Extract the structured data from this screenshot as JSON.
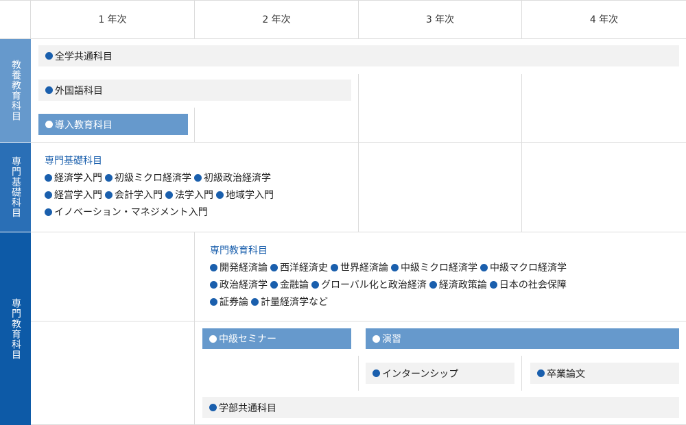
{
  "years": [
    "1 年次",
    "2 年次",
    "3 年次",
    "4 年次"
  ],
  "categories": {
    "general": "教養教育科目",
    "basic": "専門基礎科目",
    "specialized": "専門教育科目"
  },
  "general": {
    "all_common": "全学共通科目",
    "foreign_language": "外国語科目",
    "intro": "導入教育科目"
  },
  "basic": {
    "title": "専門基礎科目",
    "rows": [
      [
        "経済学入門",
        "初級ミクロ経済学",
        "初級政治経済学"
      ],
      [
        "経営学入門",
        "会計学入門",
        "法学入門",
        "地域学入門"
      ],
      [
        "イノベーション・マネジメント入門"
      ]
    ]
  },
  "specialized": {
    "title": "専門教育科目",
    "rows": [
      [
        "開発経済論",
        "西洋経済史",
        "世界経済論",
        "中級ミクロ経済学",
        "中級マクロ経済学"
      ],
      [
        "政治経済学",
        "金融論",
        "グローバル化と政治経済",
        "経済政策論",
        "日本の社会保障"
      ],
      [
        "証券論",
        "計量経済学など"
      ]
    ],
    "seminar": "中級セミナー",
    "practice": "演習",
    "internship": "インターンシップ",
    "thesis": "卒業論文",
    "faculty_common": "学部共通科目"
  },
  "colors": {
    "category_light": "#6699cc",
    "category_mid": "#2a6fb6",
    "category_dark": "#0d5aa7",
    "bullet": "#1a5fad",
    "bar_grey": "#f2f2f2"
  }
}
